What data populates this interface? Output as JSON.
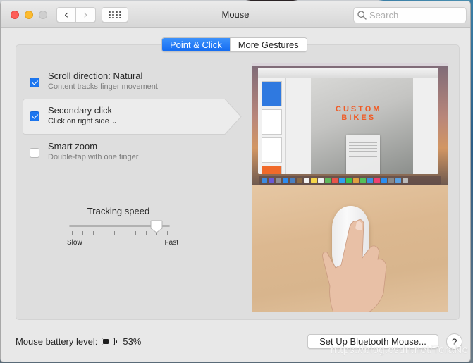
{
  "window": {
    "title": "Mouse",
    "search_placeholder": "Search",
    "search_value": ""
  },
  "toolbar": {
    "back_icon": "chevron-left-icon",
    "forward_icon": "chevron-right-icon",
    "show_all_icon": "grid-icon"
  },
  "tabs": [
    {
      "label": "Point & Click",
      "active": true
    },
    {
      "label": "More Gestures",
      "active": false
    }
  ],
  "options": [
    {
      "title": "Scroll direction: Natural",
      "subtitle": "Content tracks finger movement",
      "checked": true
    },
    {
      "title": "Secondary click",
      "subtitle": "Click on right side",
      "checked": true,
      "selected": true,
      "has_popup": true
    },
    {
      "title": "Smart zoom",
      "subtitle": "Double-tap with one finger",
      "checked": false
    }
  ],
  "tracking": {
    "label": "Tracking speed",
    "min_label": "Slow",
    "max_label": "Fast",
    "tick_count": 10,
    "value_fraction": 0.89
  },
  "preview": {
    "slide_text_line1": "CUSTOM",
    "slide_text_line2": "BIKES"
  },
  "footer": {
    "battery_label": "Mouse battery level:",
    "battery_percent": "53%",
    "battery_fraction": 0.53,
    "setup_button": "Set Up Bluetooth Mouse...",
    "help_button": "?"
  },
  "watermark": "https://blog.csdn.net/ToraNe",
  "colors": {
    "accent": "#1c76ef",
    "custom_bikes_orange": "#f05a24"
  }
}
